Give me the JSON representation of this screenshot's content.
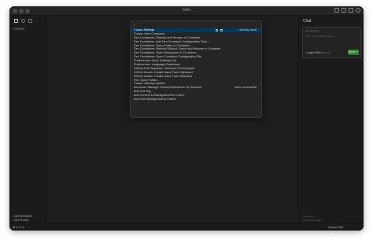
{
  "window": {
    "title": "hello"
  },
  "sidebar": {
    "tests_label": "TESTS",
    "bottom_sections": [
      "NOTEPADS",
      "OUTLINE",
      "TIMELINE"
    ]
  },
  "command_palette": {
    "query": ">",
    "items": [
      {
        "label": "Cursor Settings",
        "detail": "recently used",
        "selected": true
      },
      {
        "label": "Cursor: New Composer"
      },
      {
        "label": "Dev Containers: Rebuild and Reopen in Container"
      },
      {
        "label": "Dev Containers: Add Dev Container Configuration Files..."
      },
      {
        "label": "Dev Containers: Open Folder in Container..."
      },
      {
        "label": "Dev Containers: Rebuild Without Cache and Reopen in Container"
      },
      {
        "label": "Dev Containers: Open Workspace in Container..."
      },
      {
        "label": "Dev Containers: Open Container Configuration File"
      },
      {
        "label": "Preferences: Open Settings (UI)"
      },
      {
        "label": "Preferences: Language Extensions"
      },
      {
        "label": "GitHub Pull Requests: Checkout Pull Request"
      },
      {
        "label": "GitHub Issues: Create Issue From Clipboard"
      },
      {
        "label": "GitHub Issues: Create Issue From Selection"
      },
      {
        "label": "File: Open Folder..."
      },
      {
        "label": "Cursor: Attempt Update"
      },
      {
        "label": "Accounts: Manage Trusted Extensions For Account",
        "detail": "other commands"
      },
      {
        "label": "Add Cell Tag"
      },
      {
        "label": "Add Context to Background for Cmd K"
      },
      {
        "label": "Add Dark Background to Editors"
      }
    ]
  },
  "chat": {
    "title": "Chat",
    "hint": "Ask anything",
    "placeholder": "Plan, search, build anything",
    "agent_label": "∞ Agent ⌘I",
    "model_label": "Auto ▾  ◎",
    "send_label": "Send ⏎",
    "footer_lines": [
      "Past chats",
      "New conversation"
    ]
  },
  "statusbar": {
    "left": "⊗ 0  ⚠ 0",
    "right": "Cursor Tab"
  }
}
